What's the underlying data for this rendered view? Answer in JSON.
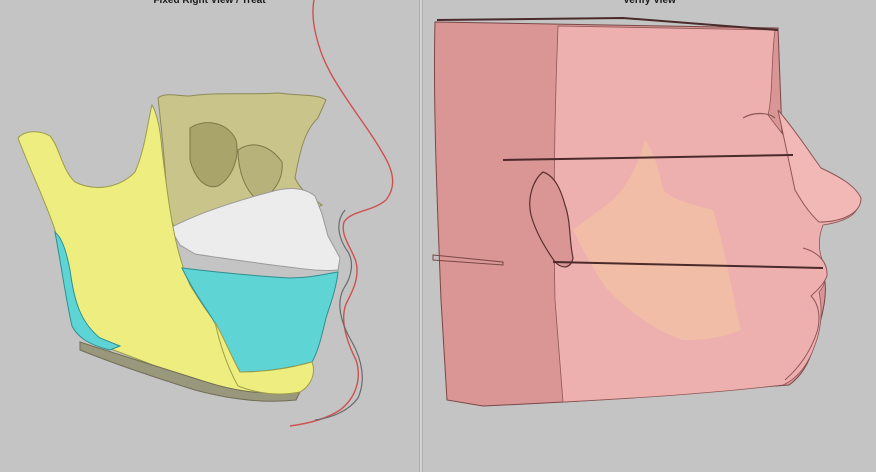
{
  "left_view": {
    "title": "Fixed Right View / Treat"
  },
  "right_view": {
    "title": "Verify View"
  },
  "colors": {
    "background": "#c4c4c4",
    "mandible": "#eeee80",
    "maxilla": "#c9c48a",
    "upper_teeth": "#ececec",
    "lower_teeth": "#5fd4d4",
    "soft_tissue_profile": "#d05050",
    "face_surface": "#eaa6a4"
  }
}
